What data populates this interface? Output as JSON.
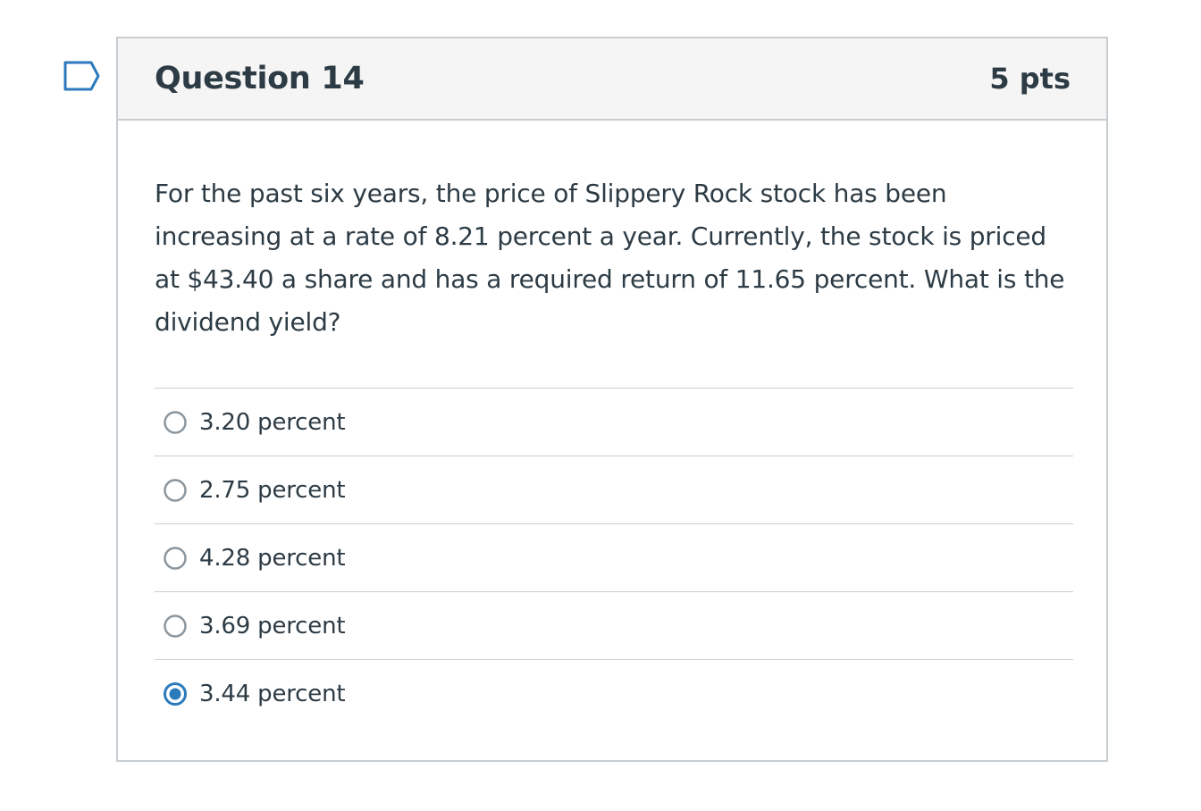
{
  "question": {
    "title": "Question 14",
    "points": "5 pts",
    "text": "For the past six years, the price of Slippery Rock stock has been increasing at a rate of 8.21 percent a year. Currently, the stock is priced at $43.40 a share and has a required return of 11.65 percent. What is the dividend yield?",
    "flag_icon": "flag-icon"
  },
  "answers": [
    {
      "label": "3.20 percent",
      "selected": false
    },
    {
      "label": "2.75 percent",
      "selected": false
    },
    {
      "label": "4.28 percent",
      "selected": false
    },
    {
      "label": "3.69 percent",
      "selected": false
    },
    {
      "label": "3.44 percent",
      "selected": true
    }
  ],
  "colors": {
    "text": "#2d3b45",
    "border": "#c7cdd1",
    "header_bg": "#f5f5f5",
    "radio_selected": "#2b7abc",
    "radio_unselected": "#8b969e",
    "flag_outline": "#2b7abc"
  }
}
